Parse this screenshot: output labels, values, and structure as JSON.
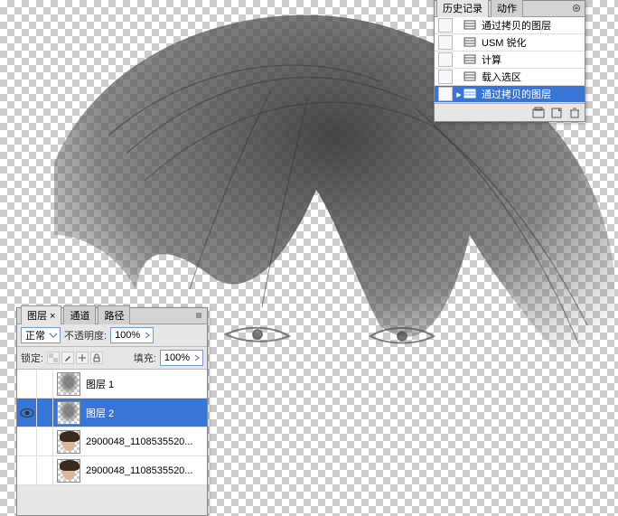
{
  "history": {
    "tabs": {
      "history": "历史记录",
      "actions": "动作"
    },
    "close_icon": "close-icon",
    "items": [
      {
        "label": "通过拷贝的图层",
        "selected": false
      },
      {
        "label": "USM 锐化",
        "selected": false
      },
      {
        "label": "计算",
        "selected": false
      },
      {
        "label": "载入选区",
        "selected": false
      },
      {
        "label": "通过拷贝的图层",
        "selected": true
      }
    ],
    "foot_icons": [
      "new-snapshot-icon",
      "new-doc-icon",
      "delete-icon"
    ]
  },
  "layers": {
    "tabs": {
      "layers": "图层",
      "channels": "通道",
      "paths": "路径"
    },
    "blend_label": "正常",
    "opacity_label": "不透明度:",
    "opacity_value": "100%",
    "lock_label": "锁定:",
    "fill_label": "填充:",
    "fill_value": "100%",
    "items": [
      {
        "name": "图层 1",
        "visible": false,
        "selected": false,
        "thumb": "gray"
      },
      {
        "name": "图层 2",
        "visible": true,
        "selected": true,
        "thumb": "gray"
      },
      {
        "name": "2900048_1108535520...",
        "visible": false,
        "selected": false,
        "thumb": "face"
      },
      {
        "name": "2900048_1108535520...",
        "visible": false,
        "selected": false,
        "thumb": "face"
      }
    ]
  }
}
